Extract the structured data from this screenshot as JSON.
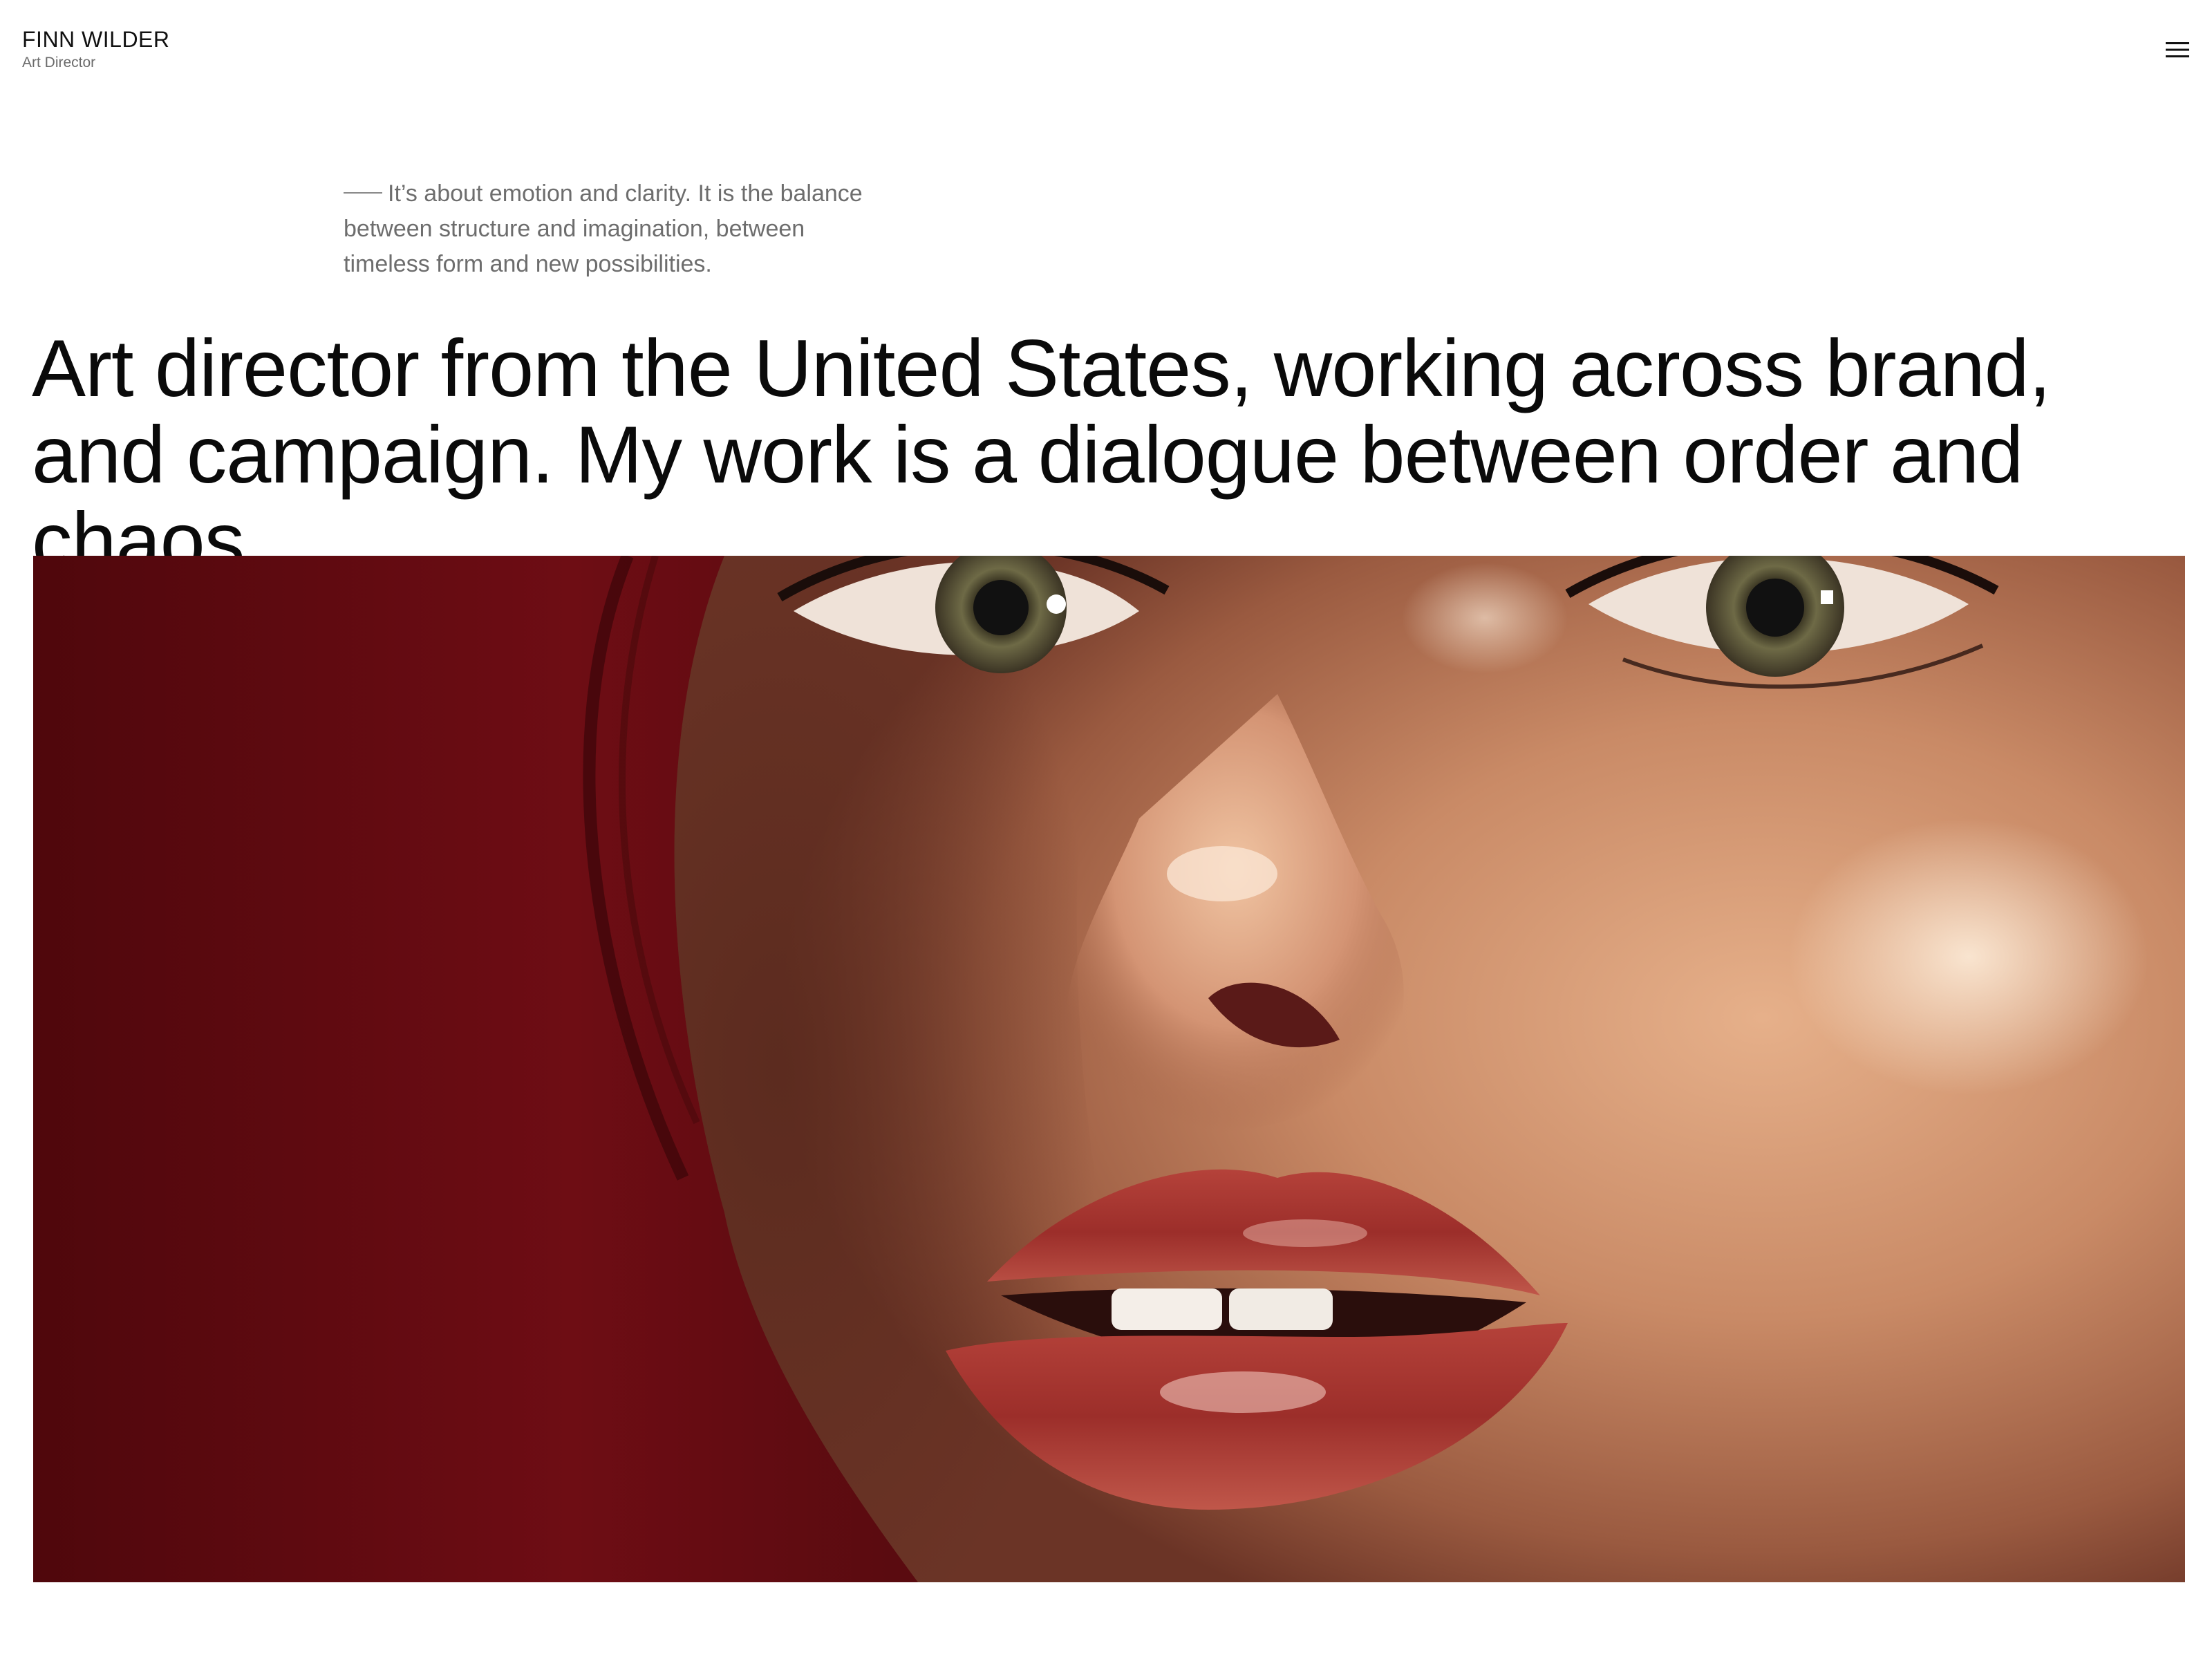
{
  "header": {
    "name": "FINN WILDER",
    "role": "Art Director",
    "menu_icon": "hamburger-menu-icon"
  },
  "intro": {
    "text": "It’s about emotion and clarity. It is the balance between structure and imagination, between timeless form and new possibilities."
  },
  "headline": {
    "text": "Art director from the United States, working across brand, and campaign. My work is a dialogue between order and chaos."
  },
  "hero": {
    "subject": "close-up portrait photograph",
    "background_color": "#6a0c12",
    "skin_color": "#c98a66",
    "lip_color": "#a8322e"
  }
}
